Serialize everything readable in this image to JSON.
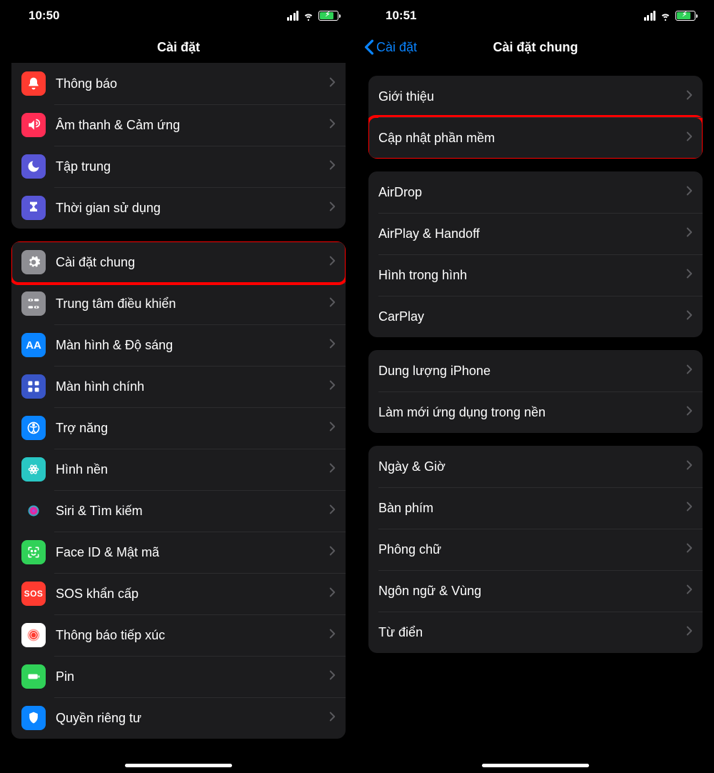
{
  "left": {
    "status_time": "10:50",
    "title": "Cài đặt",
    "groups": [
      {
        "first_cut": true,
        "rows": [
          {
            "icon": "notif",
            "label": "Thông báo"
          },
          {
            "icon": "sound",
            "label": "Âm thanh & Cảm ứng"
          },
          {
            "icon": "focus",
            "label": "Tập trung"
          },
          {
            "icon": "screentime",
            "label": "Thời gian sử dụng"
          }
        ]
      },
      {
        "rows": [
          {
            "icon": "general",
            "label": "Cài đặt chung",
            "highlight": true
          },
          {
            "icon": "control",
            "label": "Trung tâm điều khiển"
          },
          {
            "icon": "display",
            "label": "Màn hình & Độ sáng"
          },
          {
            "icon": "home",
            "label": "Màn hình chính"
          },
          {
            "icon": "access",
            "label": "Trợ năng"
          },
          {
            "icon": "wall",
            "label": "Hình nền"
          },
          {
            "icon": "siri",
            "label": "Siri & Tìm kiếm"
          },
          {
            "icon": "face",
            "label": "Face ID & Mật mã"
          },
          {
            "icon": "sos",
            "label": "SOS khẩn cấp"
          },
          {
            "icon": "exposure",
            "label": "Thông báo tiếp xúc"
          },
          {
            "icon": "batt",
            "label": "Pin"
          },
          {
            "icon": "priv",
            "label": "Quyền riêng tư"
          }
        ]
      }
    ]
  },
  "right": {
    "status_time": "10:51",
    "back_label": "Cài đặt",
    "title": "Cài đặt chung",
    "groups": [
      {
        "rows": [
          {
            "label": "Giới thiệu"
          },
          {
            "label": "Cập nhật phần mềm",
            "highlight": true
          }
        ]
      },
      {
        "rows": [
          {
            "label": "AirDrop"
          },
          {
            "label": "AirPlay & Handoff"
          },
          {
            "label": "Hình trong hình"
          },
          {
            "label": "CarPlay"
          }
        ]
      },
      {
        "rows": [
          {
            "label": "Dung lượng iPhone"
          },
          {
            "label": "Làm mới ứng dụng trong nền"
          }
        ]
      },
      {
        "rows": [
          {
            "label": "Ngày & Giờ"
          },
          {
            "label": "Bàn phím"
          },
          {
            "label": "Phông chữ"
          },
          {
            "label": "Ngôn ngữ & Vùng"
          },
          {
            "label": "Từ điển"
          }
        ]
      }
    ]
  }
}
